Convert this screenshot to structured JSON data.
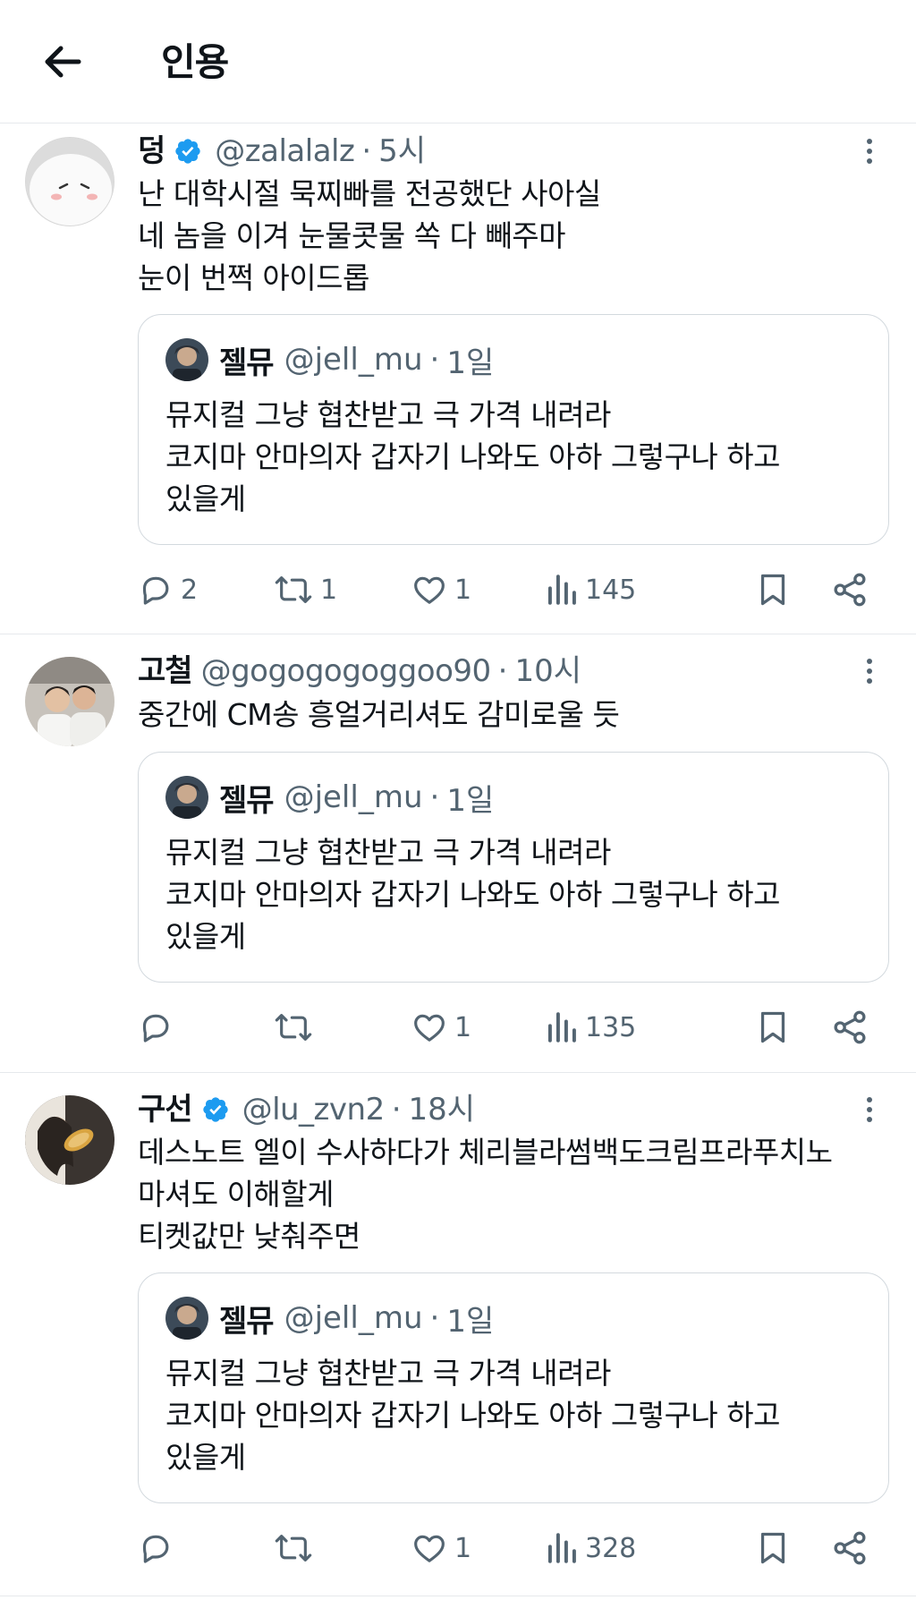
{
  "header": {
    "title": "인용"
  },
  "quoted_tweet": {
    "name": "젤뮤",
    "handle": "@jell_mu",
    "time": "1일",
    "lines": [
      "뮤지컬 그냥 협찬받고 극 가격 내려라",
      "코지마 안마의자 갑자기 나와도 아하 그렇구나 하고",
      "있을게"
    ]
  },
  "tweets": [
    {
      "name": "덩",
      "verified": true,
      "handle": "@zalalalz",
      "time": "5시",
      "lines": [
        "난 대학시절 묵찌빠를 전공했단 사아실",
        "네 놈을 이겨 눈물콧물 쏙 다 빼주마",
        "눈이 번쩍 아이드롭"
      ],
      "replies": "2",
      "retweets": "1",
      "likes": "1",
      "views": "145"
    },
    {
      "name": "고철",
      "verified": false,
      "handle": "@gogogogoggoo90",
      "time": "10시",
      "lines": [
        "중간에 CM송 흥얼거리셔도 감미로울 듯"
      ],
      "replies": "",
      "retweets": "",
      "likes": "1",
      "views": "135"
    },
    {
      "name": "구선",
      "verified": true,
      "handle": "@lu_zvn2",
      "time": "18시",
      "lines": [
        "데스노트 엘이 수사하다가 체리블라썸백도크림프라푸치노",
        "마셔도 이해할게",
        "티켓값만 낮춰주면"
      ],
      "replies": "",
      "retweets": "",
      "likes": "1",
      "views": "328"
    }
  ],
  "colors": {
    "verified": "#1d9bf0",
    "secondary_text": "#536471",
    "divider": "#e6e9ec"
  }
}
